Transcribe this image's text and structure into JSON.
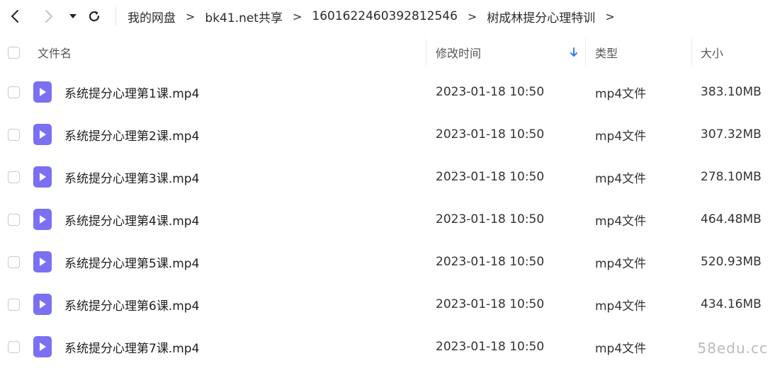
{
  "toolbar": {
    "back_icon": "chevron-left-icon",
    "forward_icon": "chevron-right-icon",
    "dropdown_icon": "caret-down-icon",
    "refresh_icon": "refresh-icon"
  },
  "breadcrumb": {
    "items": [
      "我的网盘",
      "bk41.net共享",
      "1601622460392812546",
      "树成林提分心理特训"
    ],
    "separator": ">"
  },
  "table": {
    "headers": {
      "name": "文件名",
      "modified": "修改时间",
      "type": "类型",
      "size": "大小"
    },
    "sort_icon": "arrow-down-icon",
    "accent_color": "#2f7bf5",
    "file_icon_color": "#7b6ff2",
    "rows": [
      {
        "name": "系统提分心理第1课.mp4",
        "modified": "2023-01-18 10:50",
        "type": "mp4文件",
        "size": "383.10MB"
      },
      {
        "name": "系统提分心理第2课.mp4",
        "modified": "2023-01-18 10:50",
        "type": "mp4文件",
        "size": "307.32MB"
      },
      {
        "name": "系统提分心理第3课.mp4",
        "modified": "2023-01-18 10:50",
        "type": "mp4文件",
        "size": "278.10MB"
      },
      {
        "name": "系统提分心理第4课.mp4",
        "modified": "2023-01-18 10:50",
        "type": "mp4文件",
        "size": "464.48MB"
      },
      {
        "name": "系统提分心理第5课.mp4",
        "modified": "2023-01-18 10:50",
        "type": "mp4文件",
        "size": "520.93MB"
      },
      {
        "name": "系统提分心理第6课.mp4",
        "modified": "2023-01-18 10:50",
        "type": "mp4文件",
        "size": "434.16MB"
      },
      {
        "name": "系统提分心理第7课.mp4",
        "modified": "2023-01-18 10:50",
        "type": "mp4文件",
        "size": ""
      }
    ]
  },
  "watermark": "58edu.cc"
}
